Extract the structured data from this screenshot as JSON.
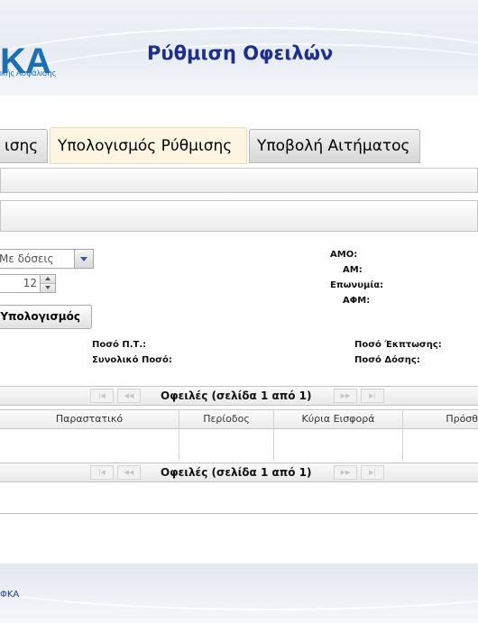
{
  "header": {
    "logo_text": "ΚΑ",
    "logo_subtitle": "ικής Ασφάλισης",
    "title": "Ρύθμιση Οφειλών"
  },
  "tabs": [
    {
      "label": "ισης",
      "active": false
    },
    {
      "label": "Υπολογισμός Ρύθμισης",
      "active": true
    },
    {
      "label": "Υποβολή Αιτήματος",
      "active": false
    }
  ],
  "form": {
    "installment_type": "Με δόσεις",
    "installments_count": "12",
    "calculate_button": "Υπολογισμός"
  },
  "employer_info": {
    "amo_label": "ΑΜΟ:",
    "am_label": "ΑΜ:",
    "name_label": "Επωνυμία:",
    "afm_label": "ΑΦΜ:"
  },
  "totals": {
    "pt_amount_label": "Ποσό Π.Τ.:",
    "total_amount_label": "Συνολικό Ποσό:",
    "discount_amount_label": "Ποσό Έκπτωσης:",
    "installment_amount_label": "Ποσό Δόσης:"
  },
  "pager": {
    "title": "Οφειλές (σελίδα 1 από 1)",
    "first": "|◀",
    "prev": "◀◀",
    "next": "▶▶",
    "last": "▶|"
  },
  "grid": {
    "columns": [
      "Παραστατικό",
      "Περίοδος",
      "Κύρια Εισφορά",
      "Πρόσθ"
    ]
  },
  "footer": {
    "text": "ΦΚΑ"
  },
  "colors": {
    "title_blue": "#1d2f88",
    "logo_blue": "#1b6fb2",
    "active_tab_bg": "#fdf5e2"
  }
}
